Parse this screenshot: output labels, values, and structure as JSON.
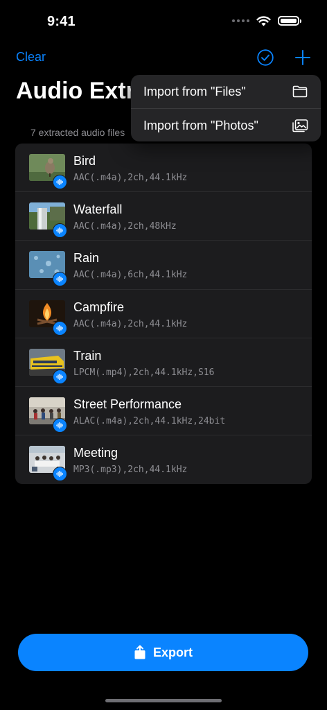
{
  "status_bar": {
    "time": "9:41"
  },
  "nav": {
    "clear_label": "Clear",
    "accent": "#0a84ff"
  },
  "title": "Audio Extr",
  "subtitle": "7 extracted audio files",
  "items": [
    {
      "title": "Bird",
      "detail": "AAC(.m4a),2ch,44.1kHz",
      "thumb": "bird-photo"
    },
    {
      "title": "Waterfall",
      "detail": "AAC(.m4a),2ch,48kHz",
      "thumb": "waterfall-photo"
    },
    {
      "title": "Rain",
      "detail": "AAC(.m4a),6ch,44.1kHz",
      "thumb": "rain-photo"
    },
    {
      "title": "Campfire",
      "detail": "AAC(.m4a),2ch,44.1kHz",
      "thumb": "campfire-photo"
    },
    {
      "title": "Train",
      "detail": "LPCM(.mp4),2ch,44.1kHz,S16",
      "thumb": "train-photo"
    },
    {
      "title": "Street Performance",
      "detail": "ALAC(.m4a),2ch,44.1kHz,24bit",
      "thumb": "street-performance-photo"
    },
    {
      "title": "Meeting",
      "detail": "MP3(.mp3),2ch,44.1kHz",
      "thumb": "meeting-photo"
    }
  ],
  "menu": {
    "items": [
      {
        "label": "Import from \"Files\"",
        "icon": "folder-icon"
      },
      {
        "label": "Import from \"Photos\"",
        "icon": "photos-icon"
      }
    ]
  },
  "export": {
    "label": "Export",
    "icon": "share-icon"
  }
}
